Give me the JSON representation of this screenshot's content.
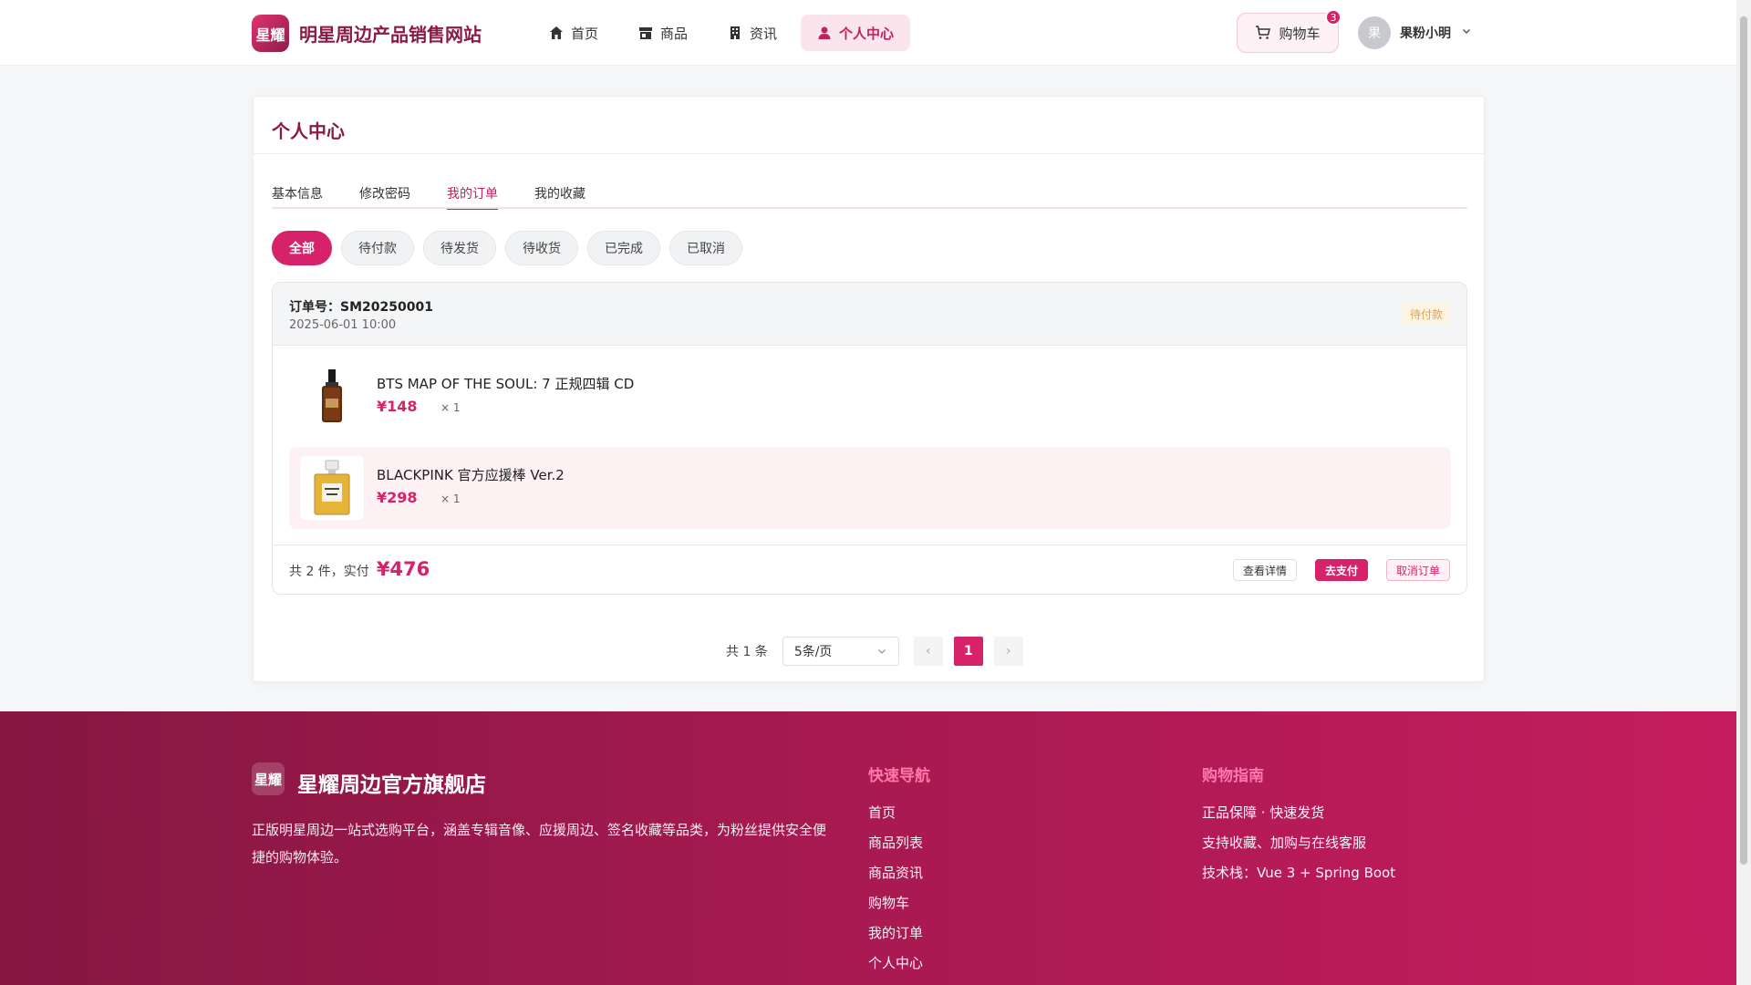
{
  "header": {
    "logo_text": "星耀",
    "site_title": "明星周边产品销售网站",
    "nav": [
      {
        "label": "首页",
        "icon": "home-icon"
      },
      {
        "label": "商品",
        "icon": "shop-icon"
      },
      {
        "label": "资讯",
        "icon": "news-icon"
      },
      {
        "label": "个人中心",
        "icon": "user-icon",
        "active": true
      }
    ],
    "cart_label": "购物车",
    "cart_count": "3",
    "avatar_text": "果",
    "username": "果粉小明"
  },
  "card": {
    "title": "个人中心",
    "tabs": [
      "基本信息",
      "修改密码",
      "我的订单",
      "我的收藏"
    ],
    "active_tab": "我的订单",
    "filters": [
      "全部",
      "待付款",
      "待发货",
      "待收货",
      "已完成",
      "已取消"
    ],
    "active_filter": "全部"
  },
  "order": {
    "order_no": "订单号：SM20250001",
    "time": "2025-06-01 10:00",
    "status": "待付款",
    "items": [
      {
        "name": "BTS MAP OF THE SOUL: 7 正规四辑 CD",
        "price": "¥148",
        "qty": "× 1"
      },
      {
        "name": "BLACKPINK 官方应援棒 Ver.2",
        "price": "¥298",
        "qty": "× 1"
      }
    ],
    "summary": "共 2 件，实付",
    "total": "¥476",
    "actions": {
      "detail": "查看详情",
      "pay": "去支付",
      "cancel": "取消订单"
    }
  },
  "pagination": {
    "total": "共 1 条",
    "page_size": "5条/页",
    "prev": "‹",
    "current": "1",
    "next": "›"
  },
  "footer": {
    "logo_text": "星耀",
    "brand": "星耀周边官方旗舰店",
    "description": "正版明星周边一站式选购平台，涵盖专辑音像、应援周边、签名收藏等品类，为粉丝提供安全便捷的购物体验。",
    "quick_nav_title": "快速导航",
    "quick_nav": [
      "首页",
      "商品列表",
      "商品资讯",
      "购物车",
      "我的订单",
      "个人中心"
    ],
    "guide_title": "购物指南",
    "guide": [
      "正品保障 · 快速发货",
      "支持收藏、加购与在线客服",
      "技术栈：Vue 3 + Spring Boot"
    ]
  },
  "colors": {
    "accent": "#d6226b",
    "brand_dark": "#8a1b46",
    "pending": "#e6a23c"
  }
}
